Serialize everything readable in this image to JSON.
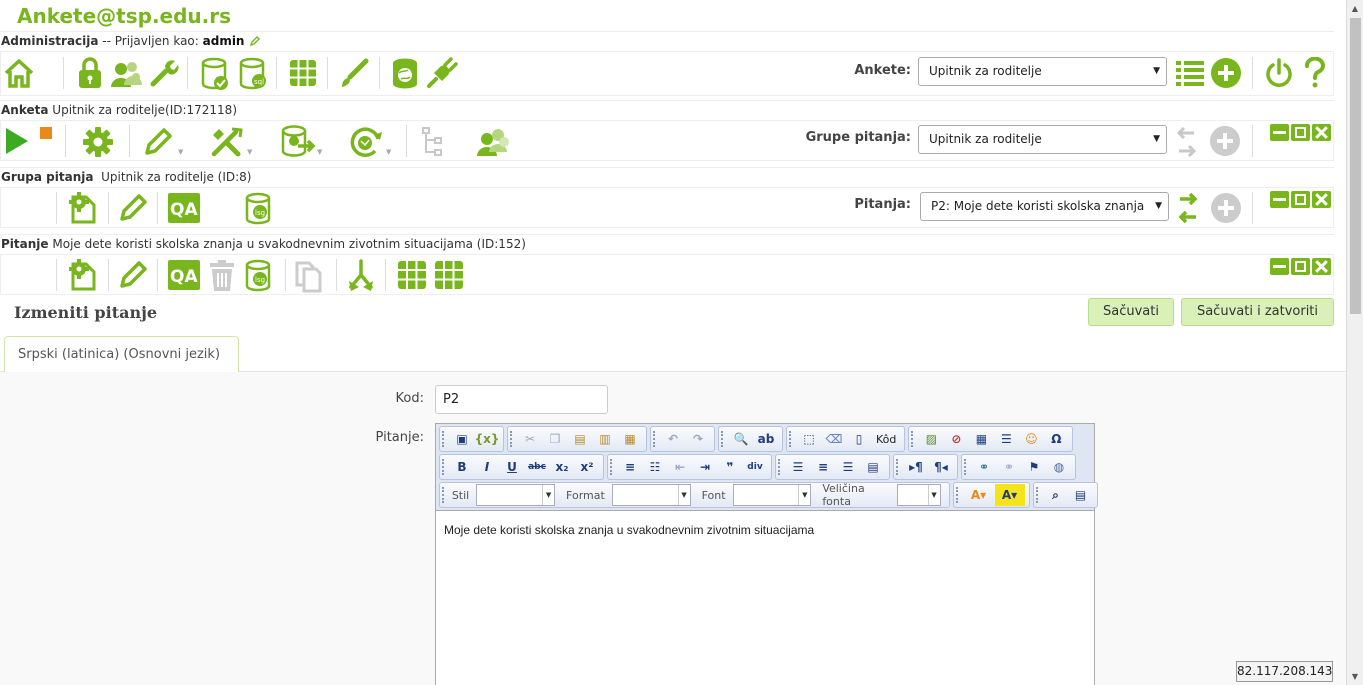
{
  "site": {
    "title": "Ankete@tsp.edu.rs"
  },
  "admin_bar": {
    "label": "Administracija",
    "logged_in_text": " -- Prijavljen kao: ",
    "user": "admin",
    "icons": [
      "home-icon",
      "lock-icon",
      "users-icon",
      "wrench-icon",
      "database-check-icon",
      "database-sql-icon",
      "grid-icon",
      "brush-icon",
      "database-world-icon",
      "plugin-icon"
    ],
    "survey_select_label": "Ankete:",
    "survey_select_value": "Upitnik za roditelje"
  },
  "survey_bar": {
    "label": "Anketa",
    "value": "Upitnik za roditelje(ID:172118)",
    "group_select_label": "Grupe pitanja:",
    "group_select_value": "Upitnik za roditelje"
  },
  "group_bar": {
    "label": "Grupa pitanja",
    "value": "Upitnik za roditelje (ID:8)",
    "question_select_label": "Pitanja:",
    "question_select_value": "P2: Moje dete koristi skolska znanja"
  },
  "question_bar": {
    "label": "Pitanje",
    "value": "Moje dete koristi skolska znanja u svakodnevnim zivotnim situacijama (ID:152)"
  },
  "edit": {
    "title": "Izmeniti pitanje",
    "save_label": "Sačuvati",
    "save_close_label": "Sačuvati i zatvoriti",
    "tab_label": "Srpski (latinica) (Osnovni jezik)"
  },
  "form": {
    "code_label": "Kod:",
    "code_value": "P2",
    "question_label": "Pitanje:"
  },
  "editor": {
    "source_label": "Kôd",
    "style_label": "Stil",
    "format_label": "Format",
    "font_label": "Font",
    "size_label": "Veličina fonta",
    "content": "Moje dete koristi skolska znanja u svakodnevnim zivotnim situacijama"
  },
  "footer": {
    "ip": "82.117.208.143"
  },
  "colors": {
    "accent": "#79b51c",
    "muted_icon": "#cccccc"
  }
}
